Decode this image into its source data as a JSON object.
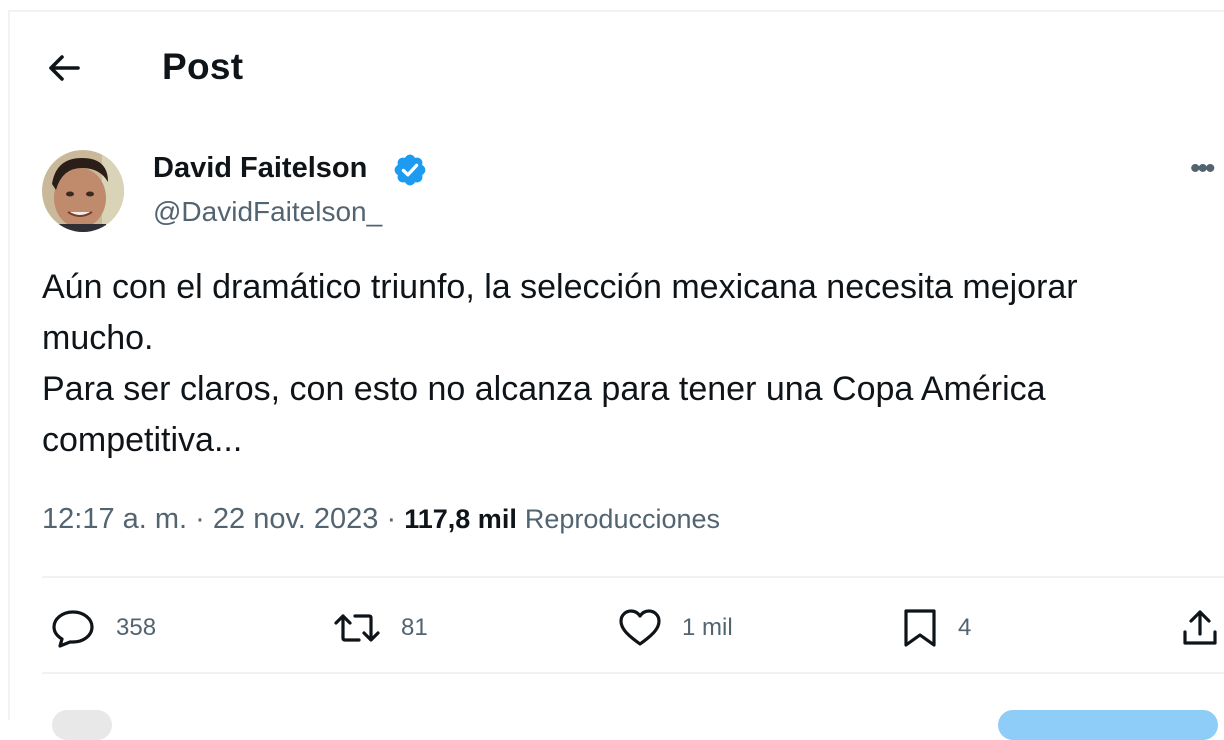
{
  "header": {
    "title": "Post",
    "back_icon": "arrow-left-icon"
  },
  "author": {
    "name": "David Faitelson",
    "handle": "@DavidFaitelson_",
    "verified": true,
    "verified_color": "#1d9bf0"
  },
  "post": {
    "text": "Aún con el dramático triunfo, la selección mexicana necesita mejorar\nmucho.\nPara ser claros, con esto no alcanza para tener una Copa América\ncompetitiva...",
    "time": "12:17 a. m.",
    "date": "22 nov. 2023",
    "separator": "·",
    "views_count": "117,8 mil",
    "views_label": "Reproducciones"
  },
  "actions": {
    "replies": {
      "icon": "reply-icon",
      "count": "358"
    },
    "reposts": {
      "icon": "repost-icon",
      "count": "81"
    },
    "likes": {
      "icon": "heart-icon",
      "count": "1 mil"
    },
    "bookmarks": {
      "icon": "bookmark-icon",
      "count": "4"
    },
    "share": {
      "icon": "share-icon"
    }
  },
  "colors": {
    "text": "#0f1419",
    "secondary": "#536471",
    "divider": "#eff3f4",
    "accent": "#1d9bf0"
  }
}
